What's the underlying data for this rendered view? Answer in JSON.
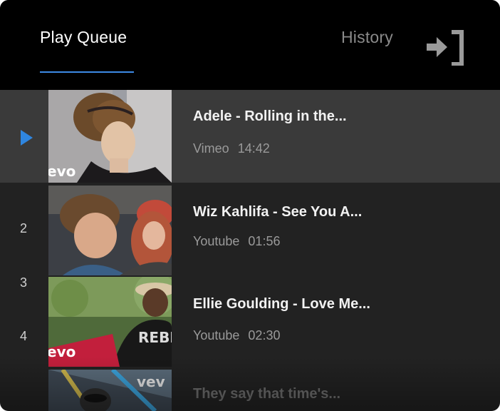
{
  "tabs": {
    "queue_label": "Play Queue",
    "history_label": "History"
  },
  "header": {
    "exit_icon": "exit-to-right-icon"
  },
  "queue": [
    {
      "number": "",
      "playing": true,
      "title": "Adele - Rolling in the...",
      "source": "Vimeo",
      "duration": "14:42",
      "thumb_watermark": "evo"
    },
    {
      "number": "2",
      "playing": false,
      "title": "Wiz Kahlifa - See You A...",
      "source": "Youtube",
      "duration": "01:56",
      "thumb_watermark": ""
    },
    {
      "number": "3",
      "playing": false,
      "title": "Ellie Goulding - Love Me...",
      "source": "Youtube",
      "duration": "02:30",
      "thumb_watermark": "evo"
    },
    {
      "number": "4",
      "playing": false,
      "title": "They say that time's...",
      "source": "",
      "duration": "",
      "thumb_watermark": "vev"
    }
  ],
  "colors": {
    "accent": "#3d8ae6",
    "header_bg": "#000000",
    "list_bg": "#222222",
    "active_row_bg": "#3a3a3a"
  }
}
